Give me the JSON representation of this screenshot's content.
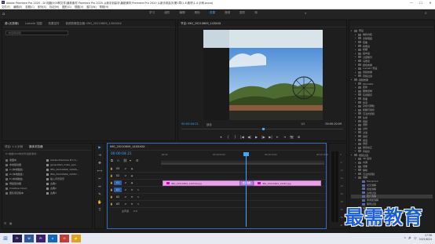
{
  "window": {
    "app_icon": "Pr",
    "title": "Adobe Premiere Pro 2020 - D:\\电脑\\500种文件\\最新素材 Premiere Pro 2020 从新手到高手\\最新素材 Premiere Pro 2020 从新手到高手\\第1章\\1.4\\素材\\1.4 示例.prproj",
    "minimize": "—",
    "maximize": "☐",
    "close": "✕"
  },
  "menu": [
    "文件(F)",
    "编辑(E)",
    "剪辑(C)",
    "序列(S)",
    "标记(M)",
    "图形(G)",
    "视图(V)",
    "窗口(W)",
    "帮助(H)"
  ],
  "workspace": {
    "tabs": [
      "学习",
      "组件",
      "编辑",
      "颜色",
      "效果",
      "音频",
      "图形",
      "库"
    ],
    "active_tab": "效果",
    "more": "»"
  },
  "source_panel": {
    "tabs": [
      "源:(无剪辑)",
      "Lumetri 范围",
      "效果控件",
      "音频剪辑混合器: IMG_20210609_14XXXXX"
    ],
    "active_tab": "源:(无剪辑)",
    "field": "(未选择剪辑)"
  },
  "program_panel": {
    "tab": "节目: IMG_20210609_143XXX",
    "timecode_left": "00:00:04:21",
    "fit": "适合",
    "resolution": "1/2",
    "timecode_right": "00:00:10:09",
    "transport": [
      "▾",
      "{",
      "}",
      "|◀",
      "◀|",
      "▶",
      "|▶",
      "▶|",
      "⇤",
      "⇥",
      "📷",
      "⊞"
    ]
  },
  "effects_panel": {
    "items": [
      {
        "indent": 0,
        "icon": "folder",
        "label": "预设"
      },
      {
        "indent": 1,
        "icon": "folder",
        "label": "卷积内核"
      },
      {
        "indent": 1,
        "icon": "folder",
        "label": "去除瑕疵"
      },
      {
        "indent": 1,
        "icon": "folder",
        "label": "扭曲"
      },
      {
        "indent": 1,
        "icon": "folder",
        "label": "斜角边"
      },
      {
        "indent": 1,
        "icon": "folder",
        "label": "模糊"
      },
      {
        "indent": 1,
        "icon": "folder",
        "label": "画中画"
      },
      {
        "indent": 1,
        "icon": "folder",
        "label": "过度曝光"
      },
      {
        "indent": 1,
        "icon": "folder",
        "label": "马赛克"
      },
      {
        "indent": 1,
        "icon": "folder",
        "label": "颜色效果"
      },
      {
        "indent": 1,
        "icon": "folder",
        "label": "Lumetri 预设"
      },
      {
        "indent": 1,
        "icon": "folder",
        "label": "音频效果"
      },
      {
        "indent": 1,
        "icon": "folder",
        "label": "音频过渡"
      },
      {
        "indent": 0,
        "icon": "folder",
        "label": "视频效果"
      },
      {
        "indent": 1,
        "icon": "folder",
        "label": "Obsolete"
      },
      {
        "indent": 1,
        "icon": "folder",
        "label": "变换"
      },
      {
        "indent": 1,
        "icon": "folder",
        "label": "图像控制"
      },
      {
        "indent": 1,
        "icon": "folder",
        "label": "实用程序"
      },
      {
        "indent": 1,
        "icon": "folder",
        "label": "扭曲"
      },
      {
        "indent": 1,
        "icon": "folder",
        "label": "时间"
      },
      {
        "indent": 1,
        "icon": "folder",
        "label": "杂色与颗粒"
      },
      {
        "indent": 1,
        "icon": "folder",
        "label": "模糊与锐化"
      },
      {
        "indent": 1,
        "icon": "folder",
        "label": "沉浸式视频"
      },
      {
        "indent": 1,
        "icon": "folder",
        "label": "生成"
      },
      {
        "indent": 1,
        "icon": "folder",
        "label": "视频"
      },
      {
        "indent": 1,
        "icon": "folder",
        "label": "调整"
      },
      {
        "indent": 1,
        "icon": "folder",
        "label": "过时"
      },
      {
        "indent": 1,
        "icon": "folder",
        "label": "过渡"
      },
      {
        "indent": 1,
        "icon": "folder",
        "label": "透视"
      },
      {
        "indent": 1,
        "icon": "folder",
        "label": "通道"
      },
      {
        "indent": 1,
        "icon": "folder",
        "label": "键控"
      },
      {
        "indent": 1,
        "icon": "folder",
        "label": "颜色校正"
      },
      {
        "indent": 1,
        "icon": "folder",
        "label": "风格化"
      },
      {
        "indent": 0,
        "icon": "folder",
        "label": "视频过渡"
      },
      {
        "indent": 1,
        "icon": "folder",
        "label": "3D 运动"
      },
      {
        "indent": 1,
        "icon": "folder",
        "label": "内滑"
      },
      {
        "indent": 1,
        "icon": "folder",
        "label": "划像"
      },
      {
        "indent": 1,
        "icon": "folder",
        "label": "擦除"
      },
      {
        "indent": 1,
        "icon": "folder",
        "label": "沉浸式视频"
      },
      {
        "indent": 1,
        "icon": "folder",
        "label": "溶解"
      },
      {
        "indent": 2,
        "icon": "fx",
        "label": "MorphCut"
      },
      {
        "indent": 2,
        "icon": "fx",
        "label": "交叉溶解"
      },
      {
        "indent": 2,
        "icon": "fx",
        "label": "叠加溶解"
      },
      {
        "indent": 2,
        "icon": "fx",
        "label": "白场过渡"
      },
      {
        "indent": 2,
        "icon": "fx",
        "label": "胶片溶解"
      },
      {
        "indent": 2,
        "icon": "fx",
        "label": "非叠加溶解"
      },
      {
        "indent": 2,
        "icon": "fx",
        "label": "黑场过渡"
      },
      {
        "indent": 1,
        "icon": "folder",
        "label": "缩放"
      },
      {
        "indent": 1,
        "icon": "folder",
        "label": "页面剥落"
      },
      {
        "indent": 0,
        "icon": "folder",
        "label": "Lumetri 预设"
      }
    ],
    "selected_index": 44
  },
  "project_panel": {
    "tabs": [
      "项目: 1.4 示例",
      "媒体浏览器"
    ],
    "active_tab": "媒体浏览器",
    "path": "D:\\电脑\\500种文件\\最新素材...",
    "rows": [
      {
        "color": "#6a6a6a",
        "label": "收藏夹"
      },
      {
        "color": "#6a6a6a",
        "label": "本地驱动器"
      },
      {
        "color": "#6a6a6a",
        "label": "C:(本地磁盘)"
      },
      {
        "color": "#6a6a6a",
        "label": "D:(本地磁盘)"
      },
      {
        "color": "#6a6a6a",
        "label": "E:(本地磁盘)"
      },
      {
        "color": "#6a6a6a",
        "label": "网络驱动器"
      },
      {
        "color": "#6a6a6a",
        "label": "Creative Cloud"
      },
      {
        "color": "#6a6a6a",
        "label": "团队项目版本"
      }
    ],
    "files": [
      "Adobe Premiere Pro A...",
      "generated_index_pp1...",
      "IMG_20210609_14345...",
      "IMG_20210609_14367...",
      "插入背景音乐",
      "古典1",
      "古典2",
      "古典3"
    ]
  },
  "tools": [
    "▶",
    "⇥",
    "✥",
    "⟷",
    "✂",
    "↔",
    "✎",
    "✋",
    "T"
  ],
  "timeline": {
    "tab": "IMG_20210609_14XXXXX",
    "timecode": "00:00:04:21",
    "ruler_marks": [
      ":00:00",
      "00:00:05:00",
      "00:00:10:00",
      "00:00:15:00"
    ],
    "tracks": [
      {
        "name": "V3",
        "on": false
      },
      {
        "name": "V2",
        "on": false
      },
      {
        "name": "V1",
        "on": true
      },
      {
        "name": "A1",
        "on": true
      },
      {
        "name": "A2",
        "on": false
      },
      {
        "name": "A3",
        "on": false
      }
    ],
    "clip1": "IMG_20210609_143XXX.jpg",
    "transition": "交叉溶解",
    "clip2": "IMG_20210609_14367.jpg",
    "master": "主声道",
    "master_value": "0.0"
  },
  "audio_meter": {
    "scale": [
      "0",
      "-6",
      "-12",
      "-18",
      "-24",
      "-30",
      "-36",
      "-42",
      "-48",
      "dB"
    ]
  },
  "watermark": "最需教育",
  "taskbar": {
    "start_icon": "⊞",
    "apps": [
      {
        "label": "Pr",
        "color": "#2a1f52"
      },
      {
        "label": "W",
        "color": "#2b579a"
      },
      {
        "label": "Pr",
        "color": "#3e1f6e"
      },
      {
        "label": "e",
        "color": "#1565c0"
      },
      {
        "label": "✉",
        "color": "#c23c3c"
      },
      {
        "label": "📁",
        "color": "#e0a21a"
      }
    ],
    "tray": [
      "∧",
      "🔊",
      "中"
    ],
    "time": "17:36",
    "date": "2021/6/24"
  },
  "colors": {
    "accent": "#3fa7ff",
    "clip": "#e6a3e6",
    "transition": "#b37fd8",
    "watermark": "#1e5fd8"
  }
}
